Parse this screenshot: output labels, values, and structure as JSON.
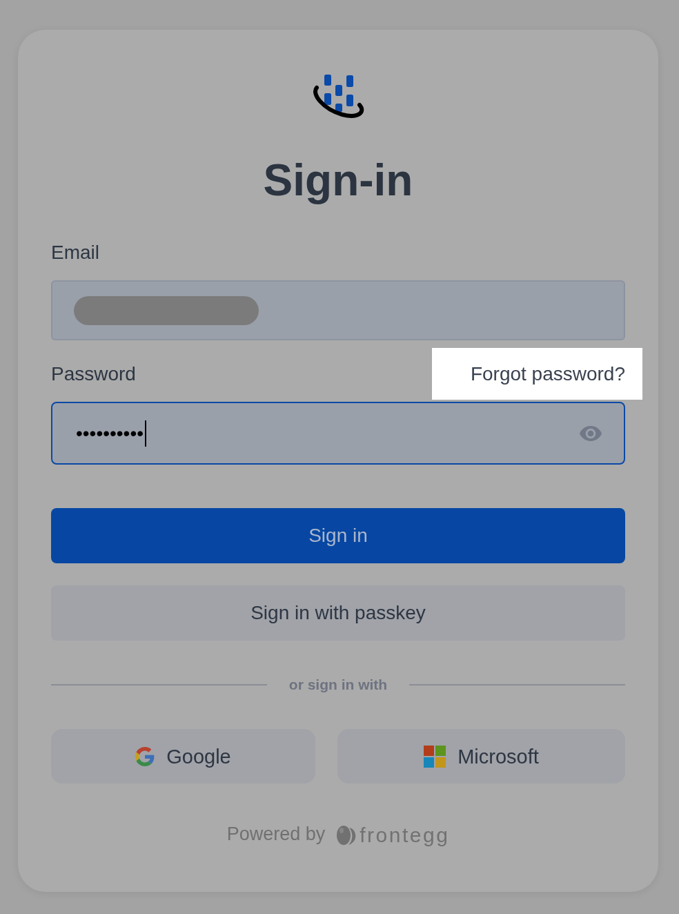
{
  "title": "Sign-in",
  "email": {
    "label": "Email",
    "redacted": true
  },
  "password": {
    "label": "Password",
    "value": "••••••••••",
    "focused": true
  },
  "forgot_password": {
    "label": "Forgot password?",
    "highlighted": true
  },
  "buttons": [
    {
      "label": "Sign in",
      "kind": "primary"
    },
    {
      "label": "Sign in with passkey",
      "kind": "secondary"
    }
  ],
  "divider": "or sign in with",
  "social": [
    {
      "label": "Google",
      "kind": "google"
    },
    {
      "label": "Microsoft",
      "kind": "microsoft"
    }
  ],
  "footer": {
    "label": "Powered by",
    "brand": "frontegg"
  }
}
